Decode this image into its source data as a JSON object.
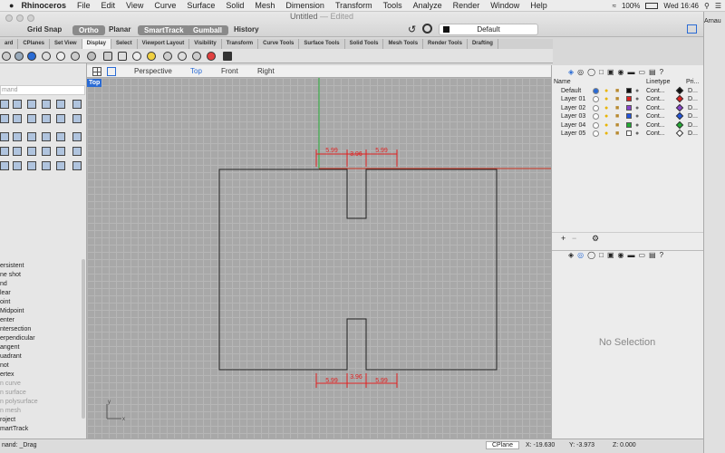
{
  "menubar": {
    "app": "Rhinoceros",
    "items": [
      "File",
      "Edit",
      "View",
      "Curve",
      "Surface",
      "Solid",
      "Mesh",
      "Dimension",
      "Transform",
      "Tools",
      "Analyze",
      "Render",
      "Window",
      "Help"
    ],
    "battery": "100%",
    "time": "Wed 16:46"
  },
  "window": {
    "title": "Untitled",
    "edited": "— Edited"
  },
  "toolbar": {
    "grid_snap": "Grid Snap",
    "ortho": "Ortho",
    "planar": "Planar",
    "smarttrack": "SmartTrack",
    "gumball": "Gumball",
    "history": "History",
    "layer": "Default"
  },
  "tabs": [
    "ard",
    "CPlanes",
    "Set View",
    "Display",
    "Select",
    "Viewport Layout",
    "Visibility",
    "Transform",
    "Curve Tools",
    "Surface Tools",
    "Solid Tools",
    "Mesh Tools",
    "Render Tools",
    "Drafting"
  ],
  "active_tab": "Display",
  "command_placeholder": "mand",
  "snaps": [
    {
      "label": "ersistent",
      "dim": false
    },
    {
      "label": "ne shot",
      "dim": false
    },
    {
      "label": "nd",
      "dim": false
    },
    {
      "label": "lear",
      "dim": false
    },
    {
      "label": "oint",
      "dim": false
    },
    {
      "label": "Midpoint",
      "dim": false
    },
    {
      "label": "enter",
      "dim": false
    },
    {
      "label": "ntersection",
      "dim": false
    },
    {
      "label": "erpendicular",
      "dim": false
    },
    {
      "label": "angent",
      "dim": false
    },
    {
      "label": "uadrant",
      "dim": false
    },
    {
      "label": "not",
      "dim": false
    },
    {
      "label": "ertex",
      "dim": false
    },
    {
      "label": "n curve",
      "dim": true
    },
    {
      "label": "n surface",
      "dim": true
    },
    {
      "label": "n polysurface",
      "dim": true
    },
    {
      "label": "n mesh",
      "dim": true
    },
    {
      "label": "roject",
      "dim": false
    },
    {
      "label": "martTrack",
      "dim": false
    }
  ],
  "viewport_tabs": [
    "Perspective",
    "Top",
    "Front",
    "Right"
  ],
  "active_viewport": "Top",
  "viewport_label": "Top",
  "dimensions": {
    "top": [
      "5.99",
      "3.96",
      "5.99"
    ],
    "bottom": [
      "5.99",
      "3.96",
      "5.99"
    ]
  },
  "axes": {
    "x": "x",
    "y": "y"
  },
  "layers": {
    "headers": {
      "name": "Name",
      "linetype": "Linetype",
      "print": "Pri..."
    },
    "rows": [
      {
        "name": "Default",
        "linetype": "Cont...",
        "color": "#111111",
        "print": "D...",
        "current": true
      },
      {
        "name": "Layer 01",
        "linetype": "Cont...",
        "color": "#dd2222",
        "print": "D...",
        "current": false
      },
      {
        "name": "Layer 02",
        "linetype": "Cont...",
        "color": "#8844cc",
        "print": "D...",
        "current": false
      },
      {
        "name": "Layer 03",
        "linetype": "Cont...",
        "color": "#2255dd",
        "print": "D...",
        "current": false
      },
      {
        "name": "Layer 04",
        "linetype": "Cont...",
        "color": "#22aa33",
        "print": "D...",
        "current": false
      },
      {
        "name": "Layer 05",
        "linetype": "Cont...",
        "color": "#ffffff",
        "print": "D...",
        "current": false
      }
    ]
  },
  "properties": {
    "no_selection": "No Selection"
  },
  "far_right": {
    "user": "Arnau"
  },
  "status": {
    "command": "nand: _Drag",
    "cplane": "CPlane",
    "x": "X: -19.630",
    "y": "Y: -3.973",
    "z": "Z: 0.000"
  }
}
